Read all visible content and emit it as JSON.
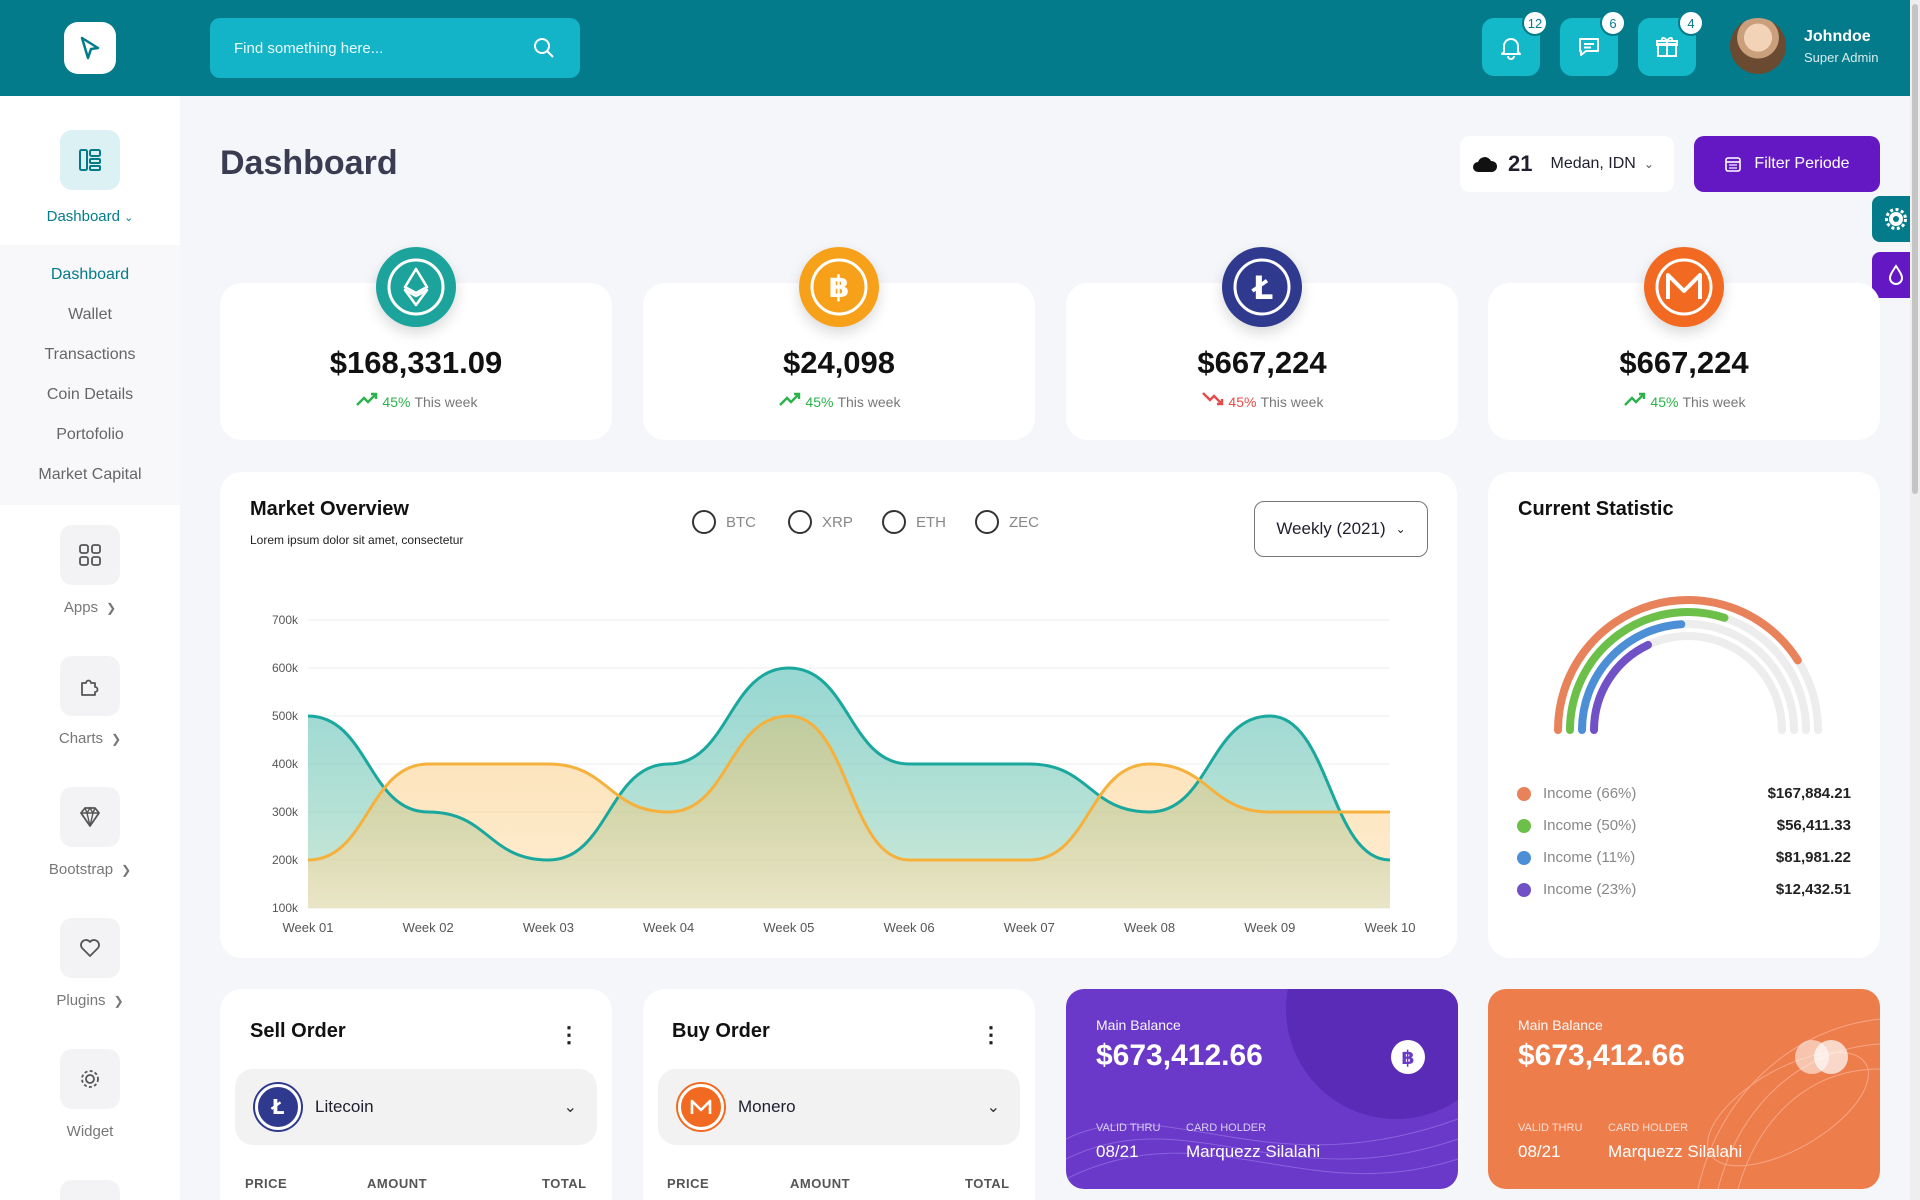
{
  "header": {
    "search_placeholder": "Find something here...",
    "notifications_count": "12",
    "messages_count": "6",
    "gifts_count": "4",
    "user_name": "Johndoe",
    "user_role": "Super Admin"
  },
  "sidebar": {
    "dashboard_label": "Dashboard",
    "sub_items": [
      "Dashboard",
      "Wallet",
      "Transactions",
      "Coin Details",
      "Portofolio",
      "Market Capital"
    ],
    "groups": [
      "Apps",
      "Charts",
      "Bootstrap",
      "Plugins",
      "Widget"
    ]
  },
  "page": {
    "title": "Dashboard",
    "weather_temp": "21",
    "weather_city": "Medan, IDN",
    "filter_label": "Filter Periode"
  },
  "coins": [
    {
      "amount": "$168,331.09",
      "pct": "45%",
      "label": "This week",
      "trend": "up",
      "color": "#1ba39c"
    },
    {
      "amount": "$24,098",
      "pct": "45%",
      "label": "This week",
      "trend": "up",
      "color": "#f7a11a"
    },
    {
      "amount": "$667,224",
      "pct": "45%",
      "label": "This week",
      "trend": "down",
      "color": "#2f3a8f"
    },
    {
      "amount": "$667,224",
      "pct": "45%",
      "label": "This week",
      "trend": "up",
      "color": "#f26a21"
    }
  ],
  "market": {
    "title": "Market Overview",
    "subtitle": "Lorem ipsum dolor sit amet, consectetur",
    "filters": [
      "BTC",
      "XRP",
      "ETH",
      "ZEC"
    ],
    "period": "Weekly (2021)"
  },
  "chart_data": {
    "type": "area",
    "categories": [
      "Week 01",
      "Week 02",
      "Week 03",
      "Week 04",
      "Week 05",
      "Week 06",
      "Week 07",
      "Week 08",
      "Week 09",
      "Week 10"
    ],
    "y_ticks": [
      "700k",
      "600k",
      "500k",
      "400k",
      "300k",
      "200k",
      "100k"
    ],
    "ylim": [
      100000,
      700000
    ],
    "grid": true,
    "series": [
      {
        "values": [
          500000,
          300000,
          200000,
          400000,
          600000,
          400000,
          400000,
          300000,
          500000,
          200000
        ],
        "color": "#1aa79d"
      },
      {
        "values": [
          200000,
          400000,
          400000,
          300000,
          500000,
          200000,
          200000,
          400000,
          300000,
          300000
        ],
        "color": "#f6b13d"
      }
    ]
  },
  "statistic": {
    "title": "Current Statistic",
    "items": [
      {
        "label": "Income (66%)",
        "value": "$167,884.21",
        "color": "#e8825a",
        "pct": 66
      },
      {
        "label": "Income (50%)",
        "value": "$56,411.33",
        "color": "#6cc04a",
        "pct": 50
      },
      {
        "label": "Income (11%)",
        "value": "$81,981.22",
        "color": "#4c8fd6",
        "pct": 11
      },
      {
        "label": "Income (23%)",
        "value": "$12,432.51",
        "color": "#7152c6",
        "pct": 23
      }
    ]
  },
  "sell_order": {
    "title": "Sell Order",
    "coin": "Litecoin",
    "cols": [
      "PRICE",
      "AMOUNT",
      "TOTAL"
    ]
  },
  "buy_order": {
    "title": "Buy Order",
    "coin": "Monero",
    "cols": [
      "PRICE",
      "AMOUNT",
      "TOTAL"
    ]
  },
  "balance_cards": [
    {
      "label": "Main Balance",
      "amount": "$673,412.66",
      "valid_label": "VALID THRU",
      "holder_label": "CARD HOLDER",
      "valid": "08/21",
      "holder": "Marquezz Silalahi"
    },
    {
      "label": "Main Balance",
      "amount": "$673,412.66",
      "valid_label": "VALID THRU",
      "holder_label": "CARD HOLDER",
      "valid": "08/21",
      "holder": "Marquezz Silalahi"
    }
  ]
}
